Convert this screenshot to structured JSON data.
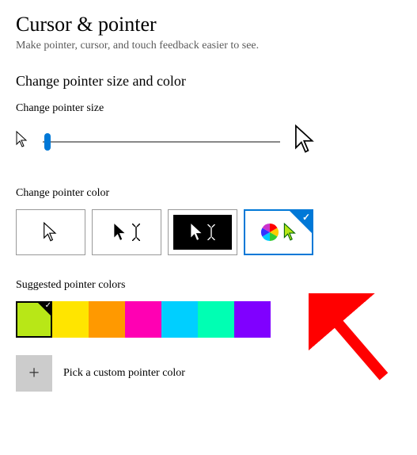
{
  "title": "Cursor & pointer",
  "subtitle": "Make pointer, cursor, and touch feedback easier to see.",
  "section_size_color": "Change pointer size and color",
  "size_label": "Change pointer size",
  "color_label": "Change pointer color",
  "suggested_label": "Suggested pointer colors",
  "custom_label": "Pick a custom pointer color",
  "color_options": [
    {
      "name": "white",
      "selected": false
    },
    {
      "name": "black",
      "selected": false
    },
    {
      "name": "inverted",
      "selected": false
    },
    {
      "name": "custom-color",
      "selected": true
    }
  ],
  "suggested_colors": [
    {
      "hex": "#b8e717",
      "selected": true
    },
    {
      "hex": "#ffe500",
      "selected": false
    },
    {
      "hex": "#ff9900",
      "selected": false
    },
    {
      "hex": "#ff00b3",
      "selected": false
    },
    {
      "hex": "#00cfff",
      "selected": false
    },
    {
      "hex": "#00ffb3",
      "selected": false
    },
    {
      "hex": "#8000ff",
      "selected": false
    }
  ],
  "slider_value": 1
}
